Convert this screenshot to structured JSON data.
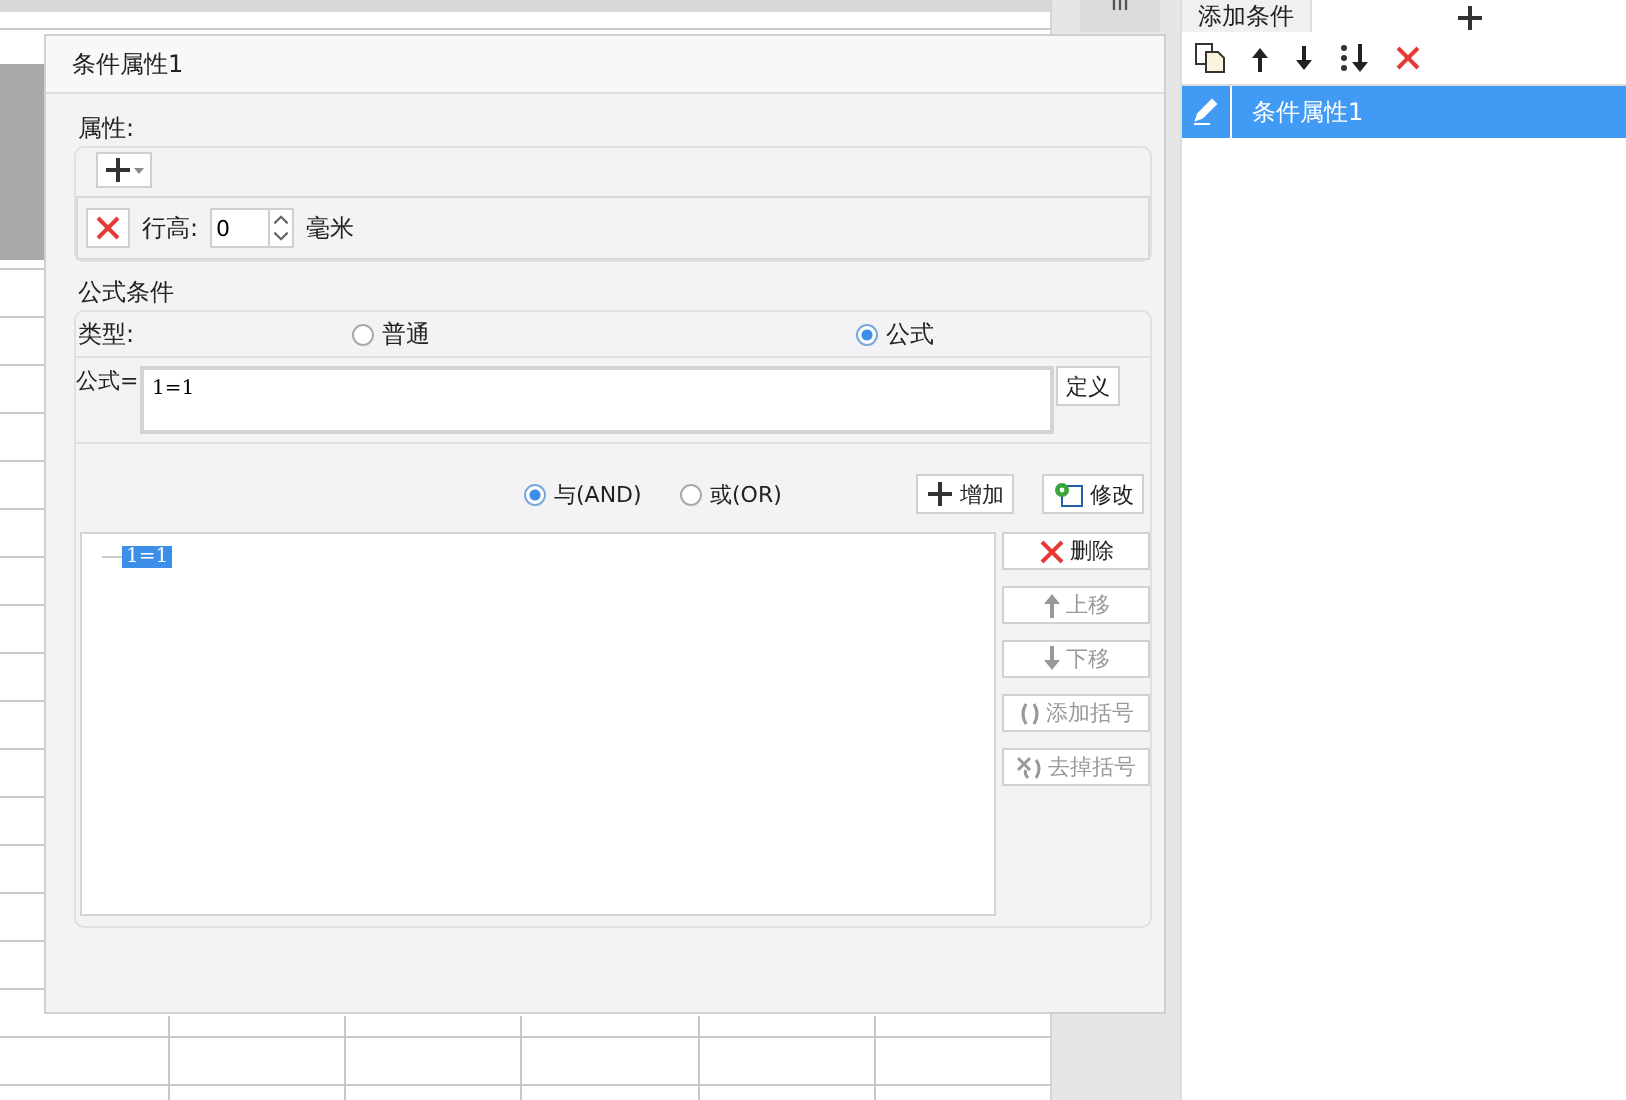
{
  "dialog": {
    "title": "条件属性1"
  },
  "attributes": {
    "legend": "属性:",
    "row_height": {
      "label": "行高:",
      "value": "0",
      "unit": "毫米"
    }
  },
  "formula_condition": {
    "legend": "公式条件",
    "type_label": "类型:",
    "types": [
      {
        "label": "普通",
        "selected": false
      },
      {
        "label": "公式",
        "selected": true
      }
    ],
    "formula_label": "公式=",
    "formula_value": "1=1",
    "define_button": "定义",
    "logic": [
      {
        "label": "与(AND)",
        "selected": true
      },
      {
        "label": "或(OR)",
        "selected": false
      }
    ],
    "add_button": "增加",
    "modify_button": "修改",
    "tree": [
      {
        "label": "1=1",
        "selected": true
      }
    ],
    "side_buttons": [
      {
        "kind": "delete",
        "label": "删除",
        "disabled": false
      },
      {
        "kind": "up",
        "label": "上移",
        "disabled": true
      },
      {
        "kind": "down",
        "label": "下移",
        "disabled": true
      },
      {
        "kind": "add_brackets",
        "label": "添加括号",
        "disabled": true
      },
      {
        "kind": "remove_brackets",
        "label": "去掉括号",
        "disabled": true
      }
    ]
  },
  "right_panel": {
    "tab": "添加条件",
    "conditions": [
      {
        "label": "条件属性1",
        "selected": true
      }
    ]
  }
}
